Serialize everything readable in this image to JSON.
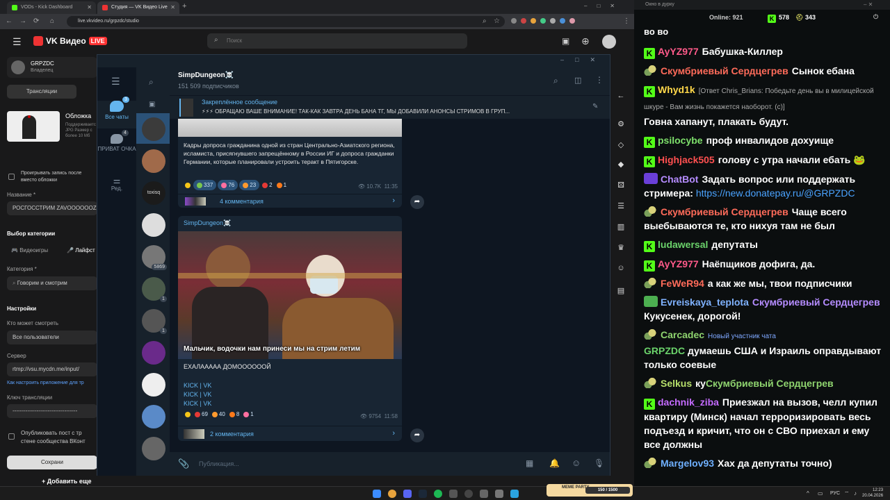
{
  "browser": {
    "tabs": [
      {
        "title": "VODs - Kick Dashboard",
        "color": "#53fc18"
      },
      {
        "title": "Студия — VK Видео Live",
        "color": "#e33"
      }
    ],
    "url": "live.vkvideo.ru/grpzdc/studio"
  },
  "vk": {
    "brand": "VK Видео",
    "live_badge": "LIVE",
    "search_placeholder": "Поиск",
    "user": {
      "name": "GRPZDC",
      "role": "Владелец"
    },
    "broadcasts_btn": "Трансляции",
    "cover_title": "Обложка",
    "cover_desc": "Поддерживается JPG Размер с более 10 Мб",
    "play_rec_label": "Проигрывать запись после вместо обложки",
    "name_label": "Название *",
    "name_value": "РОСГОССТРИМ ZAVOOOOOOZ",
    "category_section": "Выбор категории",
    "cat_games": "Видеоигры",
    "cat_life": "Лайфст",
    "category_label": "Категория *",
    "category_value": "Говорим и смотрим",
    "settings_title": "Настройки",
    "who_label": "Кто может смотреть",
    "who_value": "Все пользователи",
    "server_label": "Сервер",
    "server_value": "rtmp://vsu.mycdn.me/input/",
    "howto_link": "Как настроить приложение для тр",
    "key_label": "Ключ трансляции",
    "key_value": "-----------------------------------",
    "publish_label": "Опубликовать пост с тр стене сообщества ВКонт",
    "save_btn": "Сохрани",
    "add_btn": "Добавить еще"
  },
  "tg": {
    "folders": [
      {
        "label": "Все чаты",
        "badge": "3"
      },
      {
        "label": "ПРИВАТ ОЧКА",
        "badge": "4"
      },
      {
        "label": "Ред.",
        "badge": ""
      }
    ],
    "chat_badges": [
      "5869",
      "1",
      "1"
    ],
    "channel": {
      "name": "SimpDungeon☠️",
      "subs": "151 509 подписчиков"
    },
    "pinned": {
      "title": "Закреплённое сообщение",
      "text": "⚡⚡⚡ ОБРАЩАЮ ВАШЕ ВНИМАНИЕ! ТАК-КАК ЗАВТРА ДЕНЬ БАНА ТГ, МЫ ДОБАВИЛИ АНОНСЫ СТРИМОВ В ГРУП..."
    },
    "post1": {
      "text": "Кадры допроса гражданина одной из стран Центрально-Азиатского региона, исламиста, присягнувшего запрещённому в России ИГ и допроса гражданки Германии, которые планировали устроить теракт в Пятигорске.",
      "reactions": [
        {
          "count": "",
          "color": "#f5c518"
        },
        {
          "count": "337",
          "color": "#7ac74f"
        },
        {
          "count": "76",
          "color": "#ff6fa0"
        },
        {
          "count": "23",
          "color": "#ff9a2e"
        },
        {
          "count": "2",
          "color": "#e53935"
        },
        {
          "count": "1",
          "color": "#ff7a1a"
        }
      ],
      "views": "10.7K",
      "time": "11:35",
      "comments": "4 комментария"
    },
    "post2": {
      "author": "SimpDungeon☠️",
      "caption": "Мальчик, водочки нам принеси  мы на стрим летим",
      "text": "ЕХАЛААААА ДОМООООООЙ",
      "links": [
        "KICK | VK",
        "KICK | VK",
        "KICK | VK"
      ],
      "reactions": [
        {
          "count": "",
          "color": "#f5c518"
        },
        {
          "count": "69",
          "color": "#e53935"
        },
        {
          "count": "40",
          "color": "#ff9a2e"
        },
        {
          "count": "8",
          "color": "#ff7a1a"
        },
        {
          "count": "1",
          "color": "#ff6fa0"
        }
      ],
      "views": "9754",
      "time": "11:58",
      "comments": "2 комментария"
    },
    "composer_placeholder": "Публикация..."
  },
  "chat": {
    "window_title": "Окно в дурку",
    "online_label": "Online:",
    "online": "921",
    "kick_count": "578",
    "sub_count": "343",
    "partial_top": "во во",
    "messages": [
      {
        "badge": "kick",
        "user": "AyYZ977",
        "color": "#ff5a8a",
        "text": "Бабушка-Киллер"
      },
      {
        "badge": "sub",
        "user": "Скумбриевый Сердцегрев",
        "color": "#ff6b5a",
        "text": "Сынок ебана"
      },
      {
        "badge": "kick",
        "user": "Whyd1k",
        "color": "#ffd84a",
        "reply": "[Ответ Chris_Brians: Победьте день вы в милицейской шкуре - Вам жизнь покажется наоборот. (c)]",
        "text": "Говна хапанут, плакать будут."
      },
      {
        "badge": "kick",
        "user": "psilocybe",
        "color": "#7ee06b",
        "text": "проф инвалидов дохуище"
      },
      {
        "badge": "kick",
        "user": "Highjack505",
        "color": "#ff5050",
        "text": "голову с утра начали ебать 🐸"
      },
      {
        "badge": "bot",
        "user": "ChatBot",
        "color": "#b58cff",
        "text": "Задать вопрос или поддержать стримера: ",
        "link": "https://new.donatepay.ru/@GRPZDC"
      },
      {
        "badge": "sub",
        "user": "Скумбриевый Сердцегрев",
        "color": "#ff6b5a",
        "text": "Чаще всего выебываются те, кто нихуя там не был"
      },
      {
        "badge": "kick",
        "user": "ludawersal",
        "color": "#6bd36b",
        "text": "депутаты"
      },
      {
        "badge": "kick",
        "user": "AyYZ977",
        "color": "#ff5a8a",
        "text": "Наёпщиков дофига, да."
      },
      {
        "badge": "sub",
        "user": "FeWeR94",
        "color": "#ff6b5a",
        "text": "а как же мы, твои подписчики"
      },
      {
        "badge": "mod",
        "user": "Evreiskaya_teplota",
        "color": "#7fb2ff",
        "text": "Скумбриевый Сердцегрев Кукусенек, дорогой!",
        "mention": "Скумбриевый Сердцегрев",
        "after": " Кукусенек, дорогой!"
      },
      {
        "badge": "sub",
        "user": "Carcadec",
        "color": "#8fd46f",
        "newbie": "Новый участник чата",
        "pre": "GRPZDC",
        "text": "думаешь США и Израиль оправдывают только соевые"
      },
      {
        "badge": "sub",
        "user": "Selkus",
        "color": "#b7e06b",
        "text": "ку",
        "mention": "Скумбриевый Сердцегрев"
      },
      {
        "badge": "kick",
        "user": "dachnik_ziba",
        "color": "#c46bff",
        "text": "Приезжал на вызов, челл купил квартиру (Минск) начал терроризировать весь подъезд и кричит, что он с СВО приехал и ему все должны"
      },
      {
        "badge": "sub",
        "user": "Margelov93",
        "color": "#6fb0ff",
        "text": "Хах да депутаты точно)"
      }
    ]
  },
  "taskbar": {
    "lang": "РУС",
    "time": "12:23",
    "date": "20.04.2026",
    "widget": "MEME PARTY",
    "widget_count": "150 / 1500"
  }
}
